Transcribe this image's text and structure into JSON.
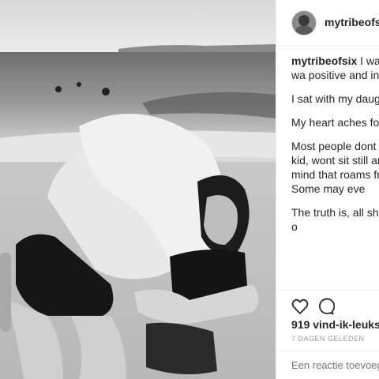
{
  "post": {
    "username": "mytribeofsix",
    "caption_paragraphs": [
      "I want t was a good day, i wa positive and inspiring today.",
      "I sat with my daughte both cried.",
      "My heart aches for al sadness.",
      "Most people dont see a loud kid, a silly kid, wont sit still and a so child with a mind that roams free and a hea spark. Some may eve",
      "The truth is, all she is as special as yours o"
    ],
    "likes": "919 vind-ik-leuks",
    "date": "7 DAGEN GELEDEN",
    "comment_placeholder": "Een reactie toevoege"
  },
  "icons": {
    "like": "heart-icon",
    "comment": "comment-bubble-icon"
  }
}
